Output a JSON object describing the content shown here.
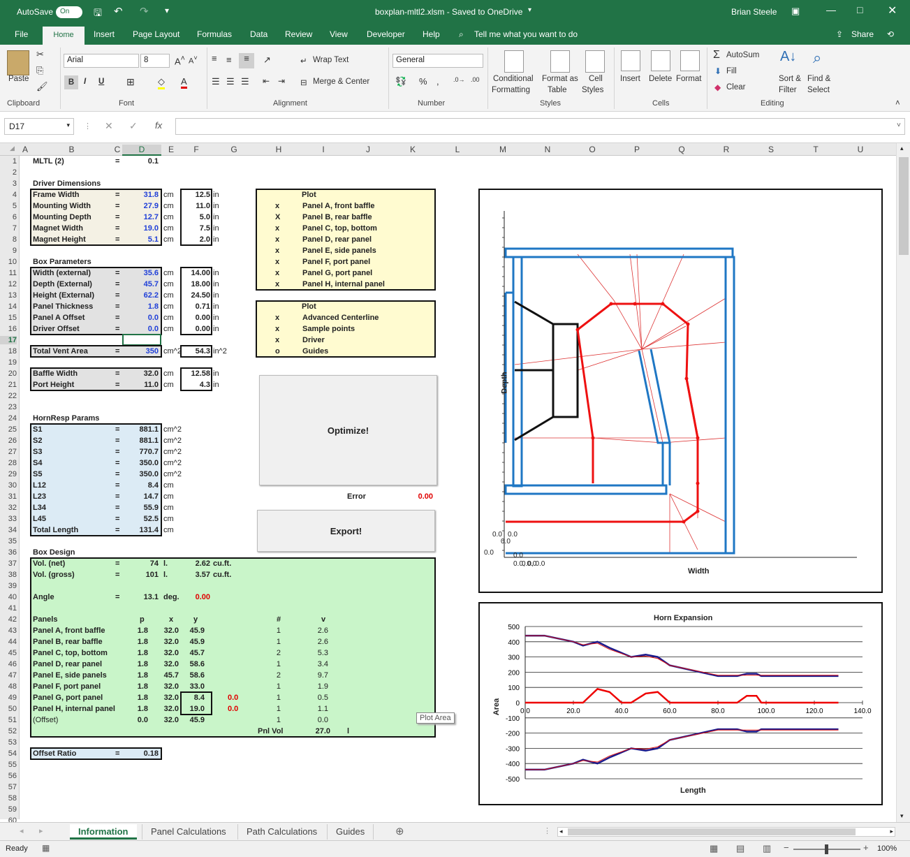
{
  "titlebar": {
    "autosave": "AutoSave",
    "toggle": "On",
    "title": "boxplan-mltl2.xlsm  -  Saved to OneDrive",
    "user": "Brian Steele"
  },
  "tabs": [
    "File",
    "Home",
    "Insert",
    "Page Layout",
    "Formulas",
    "Data",
    "Review",
    "View",
    "Developer",
    "Help"
  ],
  "tellme": "Tell me what you want to do",
  "share": "Share",
  "ribbon": {
    "paste": "Paste",
    "clipboard": "Clipboard",
    "font_name": "Arial",
    "font_size": "8",
    "font": "Font",
    "wrap": "Wrap Text",
    "merge": "Merge & Center",
    "alignment": "Alignment",
    "numfmt": "General",
    "number": "Number",
    "cond1": "Conditional",
    "cond2": "Formatting",
    "fmt1": "Format as",
    "fmt2": "Table",
    "cell1": "Cell",
    "cell2": "Styles",
    "styles": "Styles",
    "insert": "Insert",
    "delete": "Delete",
    "format": "Format",
    "cells": "Cells",
    "autosum": "AutoSum",
    "fill": "Fill",
    "clear": "Clear",
    "sort1": "Sort &",
    "sort2": "Filter",
    "find1": "Find &",
    "find2": "Select",
    "editing": "Editing"
  },
  "namebox": "D17",
  "cols": [
    "A",
    "B",
    "C",
    "D",
    "E",
    "F",
    "G",
    "H",
    "I",
    "J",
    "K",
    "L",
    "M",
    "N",
    "O",
    "P",
    "Q",
    "R",
    "S",
    "T",
    "U"
  ],
  "sheet": {
    "mltl": "MLTL (2)",
    "mltl_v": "0.1",
    "drv_title": "Driver Dimensions",
    "drv": [
      [
        "Frame Width",
        "31.8",
        "12.5"
      ],
      [
        "Mounting Width",
        "27.9",
        "11.0"
      ],
      [
        "Mounting Depth",
        "12.7",
        "5.0"
      ],
      [
        "Magnet Width",
        "19.0",
        "7.5"
      ],
      [
        "Magnet Height",
        "5.1",
        "2.0"
      ]
    ],
    "box_title": "Box Parameters",
    "box": [
      [
        "Width (external)",
        "35.6",
        "14.00"
      ],
      [
        "Depth (External)",
        "45.7",
        "18.00"
      ],
      [
        "Height (External)",
        "62.2",
        "24.50"
      ],
      [
        "Panel Thickness",
        "1.8",
        "0.71"
      ],
      [
        "Panel A Offset",
        "0.0",
        "0.00"
      ],
      [
        "Driver Offset",
        "0.0",
        "0.00"
      ]
    ],
    "tva": [
      "Total Vent Area",
      "350",
      "cm^2",
      "54.3",
      "in^2"
    ],
    "baffle": [
      [
        "Baffle Width",
        "32.0",
        "12.58"
      ],
      [
        "Port Height",
        "11.0",
        "4.3"
      ]
    ],
    "hr_title": "HornResp Params",
    "hr": [
      [
        "S1",
        "881.1",
        "cm^2"
      ],
      [
        "S2",
        "881.1",
        "cm^2"
      ],
      [
        "S3",
        "770.7",
        "cm^2"
      ],
      [
        "S4",
        "350.0",
        "cm^2"
      ],
      [
        "S5",
        "350.0",
        "cm^2"
      ],
      [
        "L12",
        "8.4",
        "cm"
      ],
      [
        "L23",
        "14.7",
        "cm"
      ],
      [
        "L34",
        "55.9",
        "cm"
      ],
      [
        "L45",
        "52.5",
        "cm"
      ],
      [
        "Total Length",
        "131.4",
        "cm"
      ]
    ],
    "eq": "=",
    "cm": "cm",
    "in": "in",
    "plot1_title": "Plot",
    "plot1": [
      [
        "x",
        "Panel A, front baffle"
      ],
      [
        "X",
        "Panel B, rear baffle"
      ],
      [
        "x",
        "Panel C, top, bottom"
      ],
      [
        "x",
        "Panel D, rear panel"
      ],
      [
        "x",
        "Panel E, side panels"
      ],
      [
        "x",
        "Panel F, port panel"
      ],
      [
        "x",
        "Panel G, port panel"
      ],
      [
        "x",
        "Panel H, internal panel"
      ]
    ],
    "plot2_title": "Plot",
    "plot2": [
      [
        "x",
        "Advanced Centerline"
      ],
      [
        "x",
        "Sample points"
      ],
      [
        "x",
        "Driver"
      ],
      [
        "o",
        "Guides"
      ]
    ],
    "optimize": "Optimize!",
    "error": "Error",
    "error_v": "0.00",
    "export": "Export!",
    "bd_title": "Box Design",
    "vol_net": [
      "Vol. (net)",
      "74",
      "l.",
      "2.62",
      "cu.ft."
    ],
    "vol_gross": [
      "Vol. (gross)",
      "101",
      "l.",
      "3.57",
      "cu.ft."
    ],
    "angle": [
      "Angle",
      "13.1",
      "deg.",
      "0.00"
    ],
    "phdr": [
      "Panels",
      "p",
      "x",
      "y",
      "#",
      "v"
    ],
    "panels": [
      [
        "Panel A, front baffle",
        "1.8",
        "32.0",
        "45.9",
        "1",
        "2.6"
      ],
      [
        "Panel B, rear baffle",
        "1.8",
        "32.0",
        "45.9",
        "1",
        "2.6"
      ],
      [
        "Panel C, top, bottom",
        "1.8",
        "32.0",
        "45.7",
        "2",
        "5.3"
      ],
      [
        "Panel D, rear panel",
        "1.8",
        "32.0",
        "58.6",
        "1",
        "3.4"
      ],
      [
        "Panel E, side panels",
        "1.8",
        "45.7",
        "58.6",
        "2",
        "9.7"
      ],
      [
        "Panel F, port panel",
        "1.8",
        "32.0",
        "33.0",
        "1",
        "1.9"
      ],
      [
        "Panel G, port panel",
        "1.8",
        "32.0",
        "8.4",
        "1",
        "0.5"
      ],
      [
        "Panel H, internal panel",
        "1.8",
        "32.0",
        "19.0",
        "1",
        "1.1"
      ],
      [
        "(Offset)",
        "0.0",
        "32.0",
        "45.9",
        "1",
        "0.0"
      ]
    ],
    "g_extra": "0.0",
    "h_extra": "0.0",
    "pnlvol": [
      "Pnl Vol",
      "27.0",
      "l"
    ],
    "offset": [
      "Offset Ratio",
      "0.18"
    ],
    "plotarea": "Plot Area"
  },
  "chart_data": [
    {
      "type": "diagram",
      "title": "",
      "xlabel": "Width",
      "ylabel": "Depth",
      "origin_labels": [
        "0.0, 0.0",
        "0.0",
        "0.0",
        "0.0",
        "0.0",
        "0.0",
        "0.0, 0.0"
      ]
    },
    {
      "type": "line",
      "title": "Horn Expansion",
      "xlabel": "Length",
      "ylabel": "Area",
      "xlim": [
        0,
        140
      ],
      "ylim": [
        -500,
        500
      ],
      "xticks": [
        "0.0",
        "20.0",
        "40.0",
        "60.0",
        "80.0",
        "100.0",
        "120.0",
        "140.0"
      ],
      "yticks": [
        "500",
        "400",
        "300",
        "200",
        "100",
        "0",
        "-100",
        "-200",
        "-300",
        "-400",
        "-500"
      ],
      "series": [
        {
          "color": "#1a1a8c",
          "x": [
            0,
            8,
            20,
            24,
            30,
            35,
            44,
            50,
            55,
            60,
            80,
            88,
            92,
            96,
            98,
            130
          ],
          "y": [
            440,
            440,
            400,
            375,
            400,
            360,
            300,
            315,
            300,
            245,
            175,
            175,
            190,
            190,
            175,
            175
          ]
        },
        {
          "color": "#dd1111",
          "x": [
            0,
            8,
            20,
            24,
            30,
            35,
            44,
            50,
            55,
            60,
            80,
            88,
            92,
            96,
            98,
            130
          ],
          "y": [
            440,
            440,
            400,
            380,
            390,
            350,
            300,
            305,
            290,
            245,
            180,
            180,
            180,
            180,
            180,
            180
          ]
        },
        {
          "color": "#ee0000",
          "x": [
            0,
            20,
            24,
            30,
            35,
            40,
            44,
            50,
            55,
            60,
            80,
            88,
            92,
            96,
            98,
            130
          ],
          "y": [
            0,
            0,
            0,
            90,
            70,
            0,
            0,
            60,
            70,
            0,
            0,
            0,
            45,
            45,
            0,
            0
          ]
        },
        {
          "color": "#1a1a8c",
          "x": [
            0,
            8,
            20,
            24,
            30,
            35,
            44,
            50,
            55,
            60,
            80,
            88,
            92,
            96,
            98,
            130
          ],
          "y": [
            -440,
            -440,
            -400,
            -375,
            -400,
            -360,
            -300,
            -315,
            -300,
            -245,
            -175,
            -175,
            -190,
            -190,
            -175,
            -175
          ]
        },
        {
          "color": "#dd1111",
          "x": [
            0,
            8,
            20,
            24,
            30,
            35,
            44,
            50,
            55,
            60,
            80,
            88,
            92,
            96,
            98,
            130
          ],
          "y": [
            -440,
            -440,
            -400,
            -380,
            -390,
            -350,
            -300,
            -305,
            -290,
            -245,
            -180,
            -180,
            -180,
            -180,
            -180,
            -180
          ]
        }
      ]
    }
  ],
  "sheettabs": [
    "Information",
    "Panel Calculations",
    "Path Calculations",
    "Guides"
  ],
  "status": {
    "ready": "Ready",
    "zoom": "100%"
  }
}
